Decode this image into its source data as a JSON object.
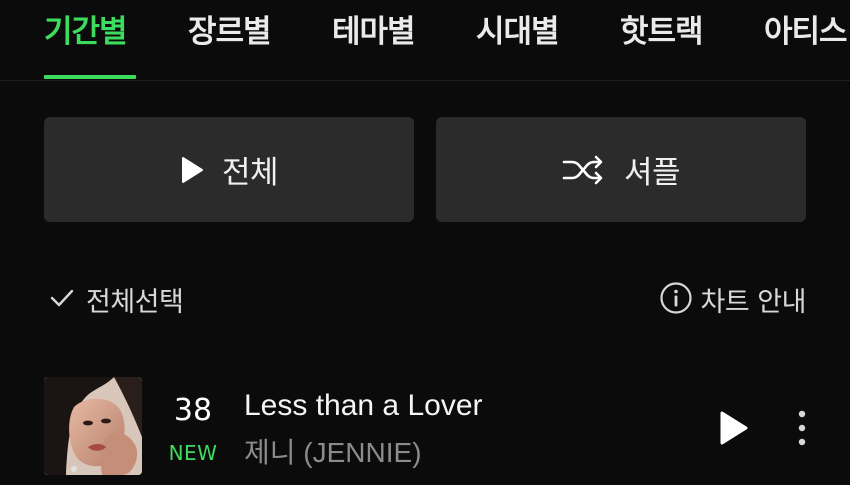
{
  "tabs": [
    {
      "label": "기간별",
      "active": true
    },
    {
      "label": "장르별",
      "active": false
    },
    {
      "label": "테마별",
      "active": false
    },
    {
      "label": "시대별",
      "active": false
    },
    {
      "label": "핫트랙",
      "active": false
    },
    {
      "label": "아티스",
      "active": false
    }
  ],
  "buttons": {
    "play_all_label": "전체",
    "shuffle_label": "셔플"
  },
  "tools": {
    "select_all_label": "전체선택",
    "chart_guide_label": "차트 안내"
  },
  "song": {
    "rank": "38",
    "badge": "NEW",
    "title": "Less than a Lover",
    "artist": "제니 (JENNIE)"
  },
  "colors": {
    "accent": "#3ddc5e",
    "background": "#0b0b0b",
    "button_bg": "#2b2b2b",
    "secondary_text": "#8b8b8b"
  },
  "icons": {
    "play": "play-icon",
    "shuffle": "shuffle-icon",
    "check": "check-icon",
    "info": "info-icon",
    "more": "more-vertical-icon"
  }
}
